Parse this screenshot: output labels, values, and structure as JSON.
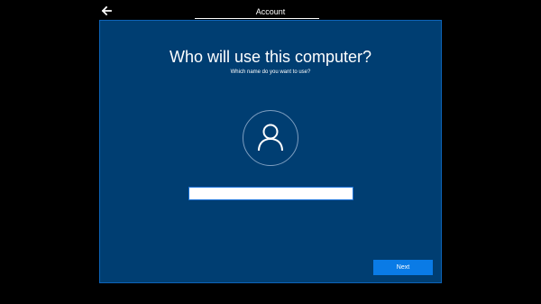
{
  "header": {
    "back_icon": "back-arrow-icon",
    "title": "Account"
  },
  "dialog": {
    "title": "Who will use this computer?",
    "subtitle": "Which name do you want to use?",
    "avatar_icon": "user-icon",
    "name_input": {
      "value": "",
      "placeholder": ""
    },
    "next_label": "Next"
  },
  "colors": {
    "background": "#000000",
    "dialog_background": "#003e72",
    "accent": "#0a7be6",
    "text": "#ffffff"
  }
}
